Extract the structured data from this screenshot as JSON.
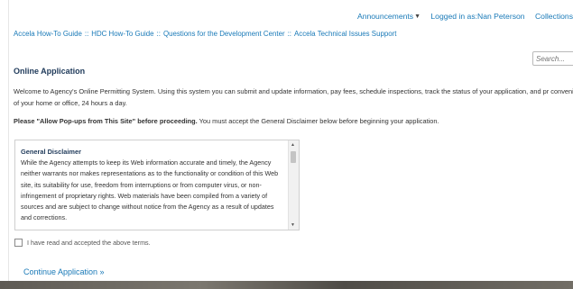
{
  "topnav": {
    "announcements": "Announcements",
    "logged_in": "Logged in as:Nan Peterson",
    "collections": "Collections"
  },
  "breadcrumbs": [
    "Accela How-To Guide",
    "HDC How-To Guide",
    "Questions for the Development Center",
    "Accela Technical Issues Support"
  ],
  "breadcrumb_separator": "::",
  "search": {
    "placeholder": "Search..."
  },
  "page_title": "Online Application",
  "welcome_text": "Welcome to Agency's Online Permitting System. Using this system you can submit and update information, pay fees, schedule inspections, track the status of your application, and pr convenience of your home or office, 24 hours a day.",
  "warning": {
    "bold": "Please \"Allow Pop-ups from This Site\" before proceeding.",
    "rest": " You must accept the General Disclaimer below before beginning your application."
  },
  "disclaimer": {
    "heading": "General Disclaimer",
    "body": "While the Agency attempts to keep its Web information accurate and timely, the Agency neither warrants nor makes representations as to the functionality or condition of this Web site, its suitability for use, freedom from interruptions or from computer virus, or non-infringement of proprietary rights. Web materials have been compiled from a variety of sources and are subject to change without notice from the Agency as a result of updates and corrections."
  },
  "accept_label": "I have read and accepted the above terms.",
  "continue_label": "Continue Application »",
  "icons": {
    "announcements_caret": "caret-down-icon",
    "scroll_up": "scroll-up-arrow-icon",
    "scroll_down": "scroll-down-arrow-icon"
  }
}
